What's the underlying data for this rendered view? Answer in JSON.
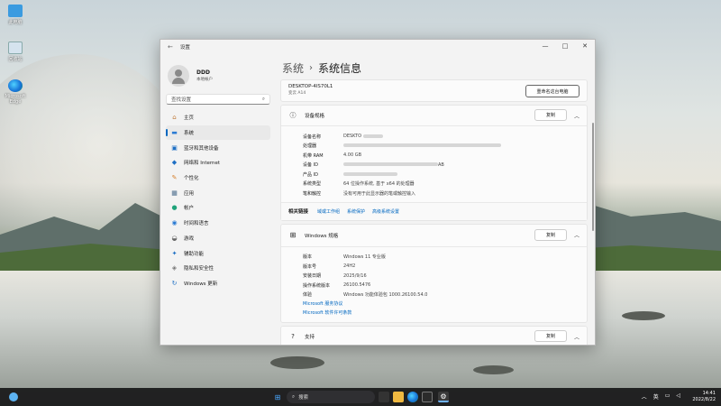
{
  "desktop": {
    "icons": [
      {
        "label": "此电脑"
      },
      {
        "label": "回收站"
      },
      {
        "label": "Microsoft Edge"
      }
    ]
  },
  "window": {
    "title": "设置",
    "controls": {
      "minimize": "—",
      "maximize": "□",
      "close": "✕"
    }
  },
  "sidebar": {
    "user_name": "DDD",
    "user_sub": "本地帐户",
    "search_placeholder": "查找设置",
    "items": [
      {
        "label": "主页",
        "icon": "home-icon"
      },
      {
        "label": "系统",
        "icon": "system-icon"
      },
      {
        "label": "蓝牙和其他设备",
        "icon": "bluetooth-icon"
      },
      {
        "label": "网络和 Internet",
        "icon": "wifi-icon"
      },
      {
        "label": "个性化",
        "icon": "brush-icon"
      },
      {
        "label": "应用",
        "icon": "apps-icon"
      },
      {
        "label": "帐户",
        "icon": "account-icon"
      },
      {
        "label": "时间和语言",
        "icon": "globe-icon"
      },
      {
        "label": "游戏",
        "icon": "gamepad-icon"
      },
      {
        "label": "辅助功能",
        "icon": "accessibility-icon"
      },
      {
        "label": "隐私和安全性",
        "icon": "shield-icon"
      },
      {
        "label": "Windows 更新",
        "icon": "update-icon"
      }
    ],
    "active_index": 1
  },
  "breadcrumb": {
    "parent": "系统",
    "sep": "›",
    "current": "系统信息"
  },
  "device": {
    "name": "DESKTOP-4IS70L1",
    "model": "变云 A14",
    "rename_button": "重命名这台电脑"
  },
  "device_specs": {
    "title": "设备规格",
    "copy_button": "复制",
    "rows": [
      {
        "key": "设备名称",
        "value": "DESKTO"
      },
      {
        "key": "处理器",
        "value": ""
      },
      {
        "key": "机带 RAM",
        "value": "4.00 GB"
      },
      {
        "key": "设备 ID",
        "value": "AB"
      },
      {
        "key": "产品 ID",
        "value": ""
      },
      {
        "key": "系统类型",
        "value": "64 位操作系统, 基于 x64 的处理器"
      },
      {
        "key": "笔和触控",
        "value": "没有可用于此显示器的笔或触控输入"
      }
    ]
  },
  "related": {
    "label": "相关链接",
    "links": [
      "域或工作组",
      "系统保护",
      "高级系统设置"
    ]
  },
  "windows_specs": {
    "title": "Windows 规格",
    "copy_button": "复制",
    "rows": [
      {
        "key": "版本",
        "value": "Windows 11 专业版"
      },
      {
        "key": "版本号",
        "value": "24H2"
      },
      {
        "key": "安装日期",
        "value": "2025/9/16"
      },
      {
        "key": "操作系统版本",
        "value": "26100.5476"
      },
      {
        "key": "体验",
        "value": "Windows 功能体验包 1000.26100.54.0"
      }
    ],
    "links": [
      "Microsoft 服务协议",
      "Microsoft 软件许可条款"
    ]
  },
  "support": {
    "title": "支持",
    "copy_button": "复制"
  },
  "taskbar": {
    "search_label": "搜索",
    "tray_lang": "英",
    "time": "14:41",
    "date": "2022/8/22"
  }
}
